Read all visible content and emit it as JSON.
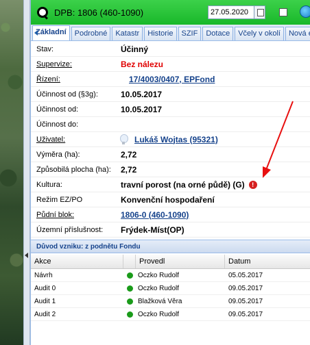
{
  "header": {
    "title": "DPB: 1806 (460-1090)",
    "date_value": "27.05.2020"
  },
  "tabs": [
    "Základní",
    "Podrobné",
    "Katastr",
    "Historie",
    "SZIF",
    "Dotace",
    "Včely v okolí",
    "Nová er"
  ],
  "props": {
    "stav": {
      "label": "Stav:",
      "value": "Účinný"
    },
    "supervize": {
      "label": "Supervize:",
      "value": "Bez nálezu"
    },
    "rizeni": {
      "label": "Řízení:",
      "value": "17/4003/0407, EPFond"
    },
    "ucinnost_3g": {
      "label": "Účinnost od (§3g):",
      "value": "10.05.2017"
    },
    "ucinnost_od": {
      "label": "Účinnost od:",
      "value": "10.05.2017"
    },
    "ucinnost_do": {
      "label": "Účinnost do:",
      "value": ""
    },
    "uzivatel": {
      "label": "Uživatel:",
      "value": "Lukáš Wojtas (95321)"
    },
    "vymera": {
      "label": "Výměra (ha):",
      "value": "2,72"
    },
    "zpusobila": {
      "label": "Způsobilá plocha (ha):",
      "value": "2,72"
    },
    "kultura": {
      "label": "Kultura:",
      "value": "travní porost (na orné půdě) (G)"
    },
    "rezim": {
      "label": "Režim EZ/PO",
      "value": "Konvenční hospodaření"
    },
    "pudni_blok": {
      "label": "Půdní blok:",
      "value": "1806-0 (460-1090)"
    },
    "uzemni": {
      "label": "Územní příslušnost:",
      "value": "Frýdek-Míst(OP)"
    }
  },
  "section": {
    "title": "Důvod vzniku: z podnětu Fondu"
  },
  "grid": {
    "headers": {
      "akce": "Akce",
      "provedl": "Provedl",
      "datum": "Datum"
    },
    "rows": [
      {
        "akce": "Návrh",
        "provedl": "Oczko Rudolf",
        "datum": "05.05.2017"
      },
      {
        "akce": "Audit 0",
        "provedl": "Oczko Rudolf",
        "datum": "09.05.2017"
      },
      {
        "akce": "Audit 1",
        "provedl": "Blažková Věra",
        "datum": "09.05.2017"
      },
      {
        "akce": "Audit 2",
        "provedl": "Oczko Rudolf",
        "datum": "09.05.2017"
      }
    ]
  },
  "icons": {
    "search": "search-icon",
    "calendar": "calendar-icon",
    "refresh": "refresh-icon",
    "bulb": "lightbulb-icon",
    "warning": "warning-icon",
    "status_dot": "status-dot-icon"
  },
  "colors": {
    "header_green": "#19b82a",
    "link_blue": "#15428b",
    "alert_red": "#e00000",
    "status_green": "#1a9b1a"
  }
}
